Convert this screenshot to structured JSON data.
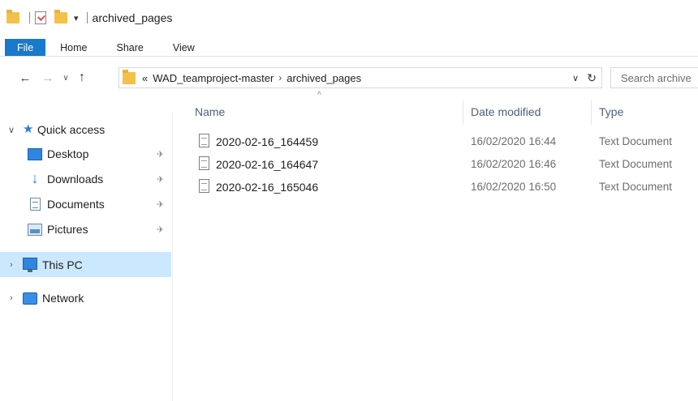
{
  "window": {
    "title": "archived_pages"
  },
  "ribbon": {
    "tabs": [
      {
        "label": "File"
      },
      {
        "label": "Home"
      },
      {
        "label": "Share"
      },
      {
        "label": "View"
      }
    ]
  },
  "address": {
    "overflow": "«",
    "crumbs": [
      "WAD_teamproject-master",
      "archived_pages"
    ],
    "search_placeholder": "Search archive"
  },
  "nav_pane": {
    "quick_access_label": "Quick access",
    "quick_items": [
      {
        "label": "Desktop",
        "icon": "desktop-icon",
        "pinned": true
      },
      {
        "label": "Downloads",
        "icon": "downloads-icon",
        "pinned": true
      },
      {
        "label": "Documents",
        "icon": "documents-icon",
        "pinned": true
      },
      {
        "label": "Pictures",
        "icon": "pictures-icon",
        "pinned": true
      }
    ],
    "this_pc_label": "This PC",
    "network_label": "Network"
  },
  "file_list": {
    "columns": [
      "Name",
      "Date modified",
      "Type"
    ],
    "rows": [
      {
        "name": "2020-02-16_164459",
        "date": "16/02/2020 16:44",
        "type": "Text Document"
      },
      {
        "name": "2020-02-16_164647",
        "date": "16/02/2020 16:46",
        "type": "Text Document"
      },
      {
        "name": "2020-02-16_165046",
        "date": "16/02/2020 16:50",
        "type": "Text Document"
      }
    ]
  },
  "colors": {
    "file_tab": "#1979ca",
    "selected_nav": "#cce8ff",
    "folder": "#f3c14a"
  }
}
